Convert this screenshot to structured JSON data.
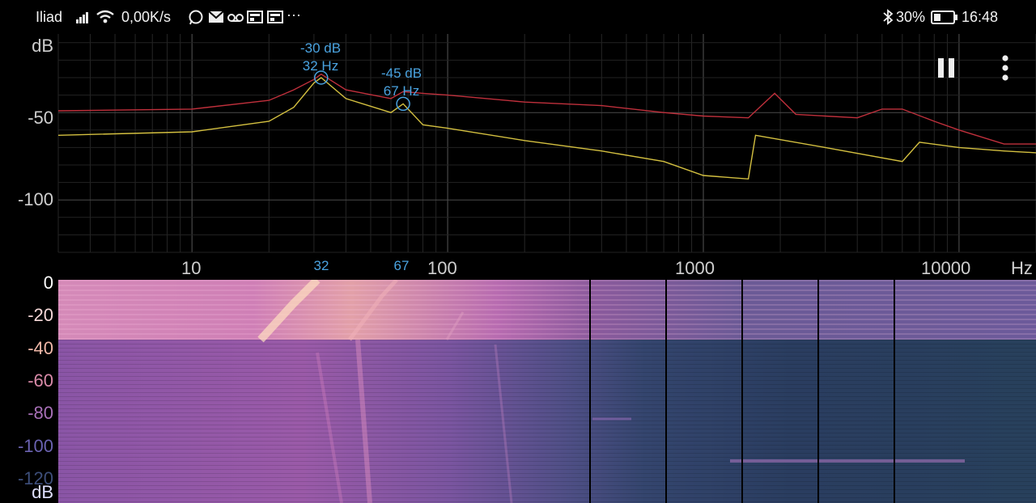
{
  "status_bar": {
    "carrier": "Iliad",
    "net_speed": "0,00K/s",
    "more": "···",
    "battery": "30%",
    "time": "16:48"
  },
  "spectrum": {
    "y_unit": "dB",
    "y_ticks": [
      "-50",
      "-100"
    ],
    "x_unit": "Hz",
    "x_ticks": [
      "10",
      "100",
      "1000",
      "10000"
    ],
    "peaks": [
      {
        "db": "-30 dB",
        "hz": "32 Hz",
        "marker": "32"
      },
      {
        "db": "-45 dB",
        "hz": "67 Hz",
        "marker": "67"
      }
    ]
  },
  "spectrogram": {
    "unit": "dB",
    "scale": [
      {
        "label": "0",
        "color": "#ffffff"
      },
      {
        "label": "-20",
        "color": "#f5d8d8"
      },
      {
        "label": "-40",
        "color": "#f0b8a8"
      },
      {
        "label": "-60",
        "color": "#d98aa8"
      },
      {
        "label": "-80",
        "color": "#a870b8"
      },
      {
        "label": "-100",
        "color": "#6a62b0"
      },
      {
        "label": "-120",
        "color": "#3d4e7a"
      }
    ]
  },
  "chart_data": {
    "type": "line",
    "xlabel": "Hz",
    "ylabel": "dB",
    "x_scale": "log",
    "xlim": [
      3,
      20000
    ],
    "ylim": [
      -130,
      -5
    ],
    "grid": true,
    "series": [
      {
        "color": "#c0303c",
        "x": [
          3,
          10,
          20,
          25,
          30,
          32,
          40,
          60,
          67,
          80,
          100,
          200,
          400,
          700,
          1000,
          1500,
          1900,
          2300,
          3000,
          4000,
          5000,
          6000,
          8000,
          10000,
          15000,
          20000
        ],
        "y": [
          -49,
          -48,
          -43,
          -37,
          -31,
          -28,
          -37,
          -42,
          -38,
          -39,
          -40,
          -44,
          -46,
          -50,
          -52,
          -53,
          -39,
          -51,
          -52,
          -53,
          -48,
          -48,
          -55,
          -60,
          -68,
          -68
        ]
      },
      {
        "color": "#d4c040",
        "x": [
          3,
          10,
          20,
          25,
          30,
          32,
          40,
          60,
          67,
          80,
          100,
          200,
          400,
          700,
          1000,
          1500,
          1600,
          3000,
          6000,
          7000,
          10000,
          15000,
          20000
        ],
        "y": [
          -63,
          -61,
          -55,
          -47,
          -33,
          -30,
          -42,
          -50,
          -45,
          -57,
          -59,
          -66,
          -72,
          -78,
          -86,
          -88,
          -63,
          -70,
          -78,
          -67,
          -70,
          -72,
          -73
        ]
      }
    ],
    "peaks": [
      {
        "x": 32,
        "y": -30
      },
      {
        "x": 67,
        "y": -45
      }
    ]
  }
}
